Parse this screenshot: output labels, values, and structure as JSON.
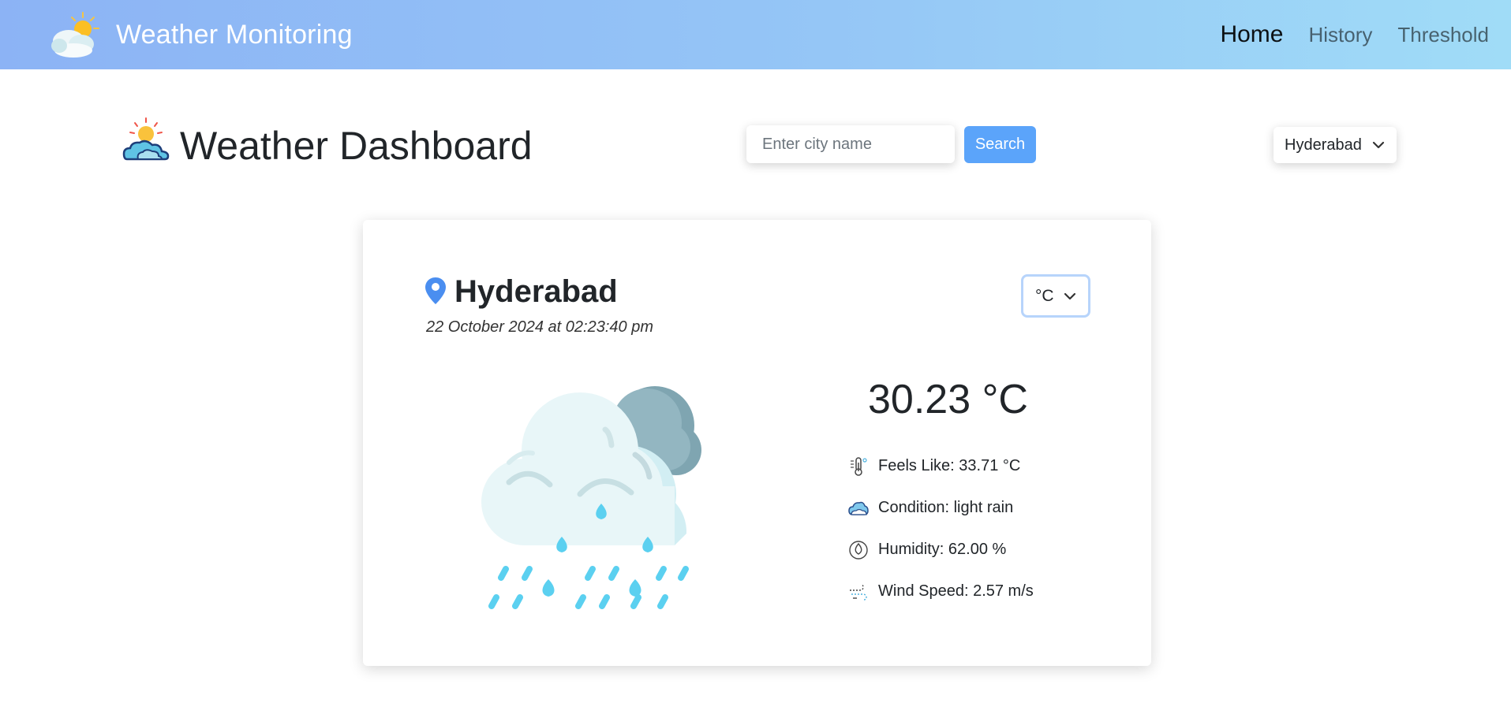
{
  "navbar": {
    "brand": "Weather Monitoring",
    "brand_icon": "sun-cloud-icon",
    "links": [
      {
        "label": "Home",
        "active": true
      },
      {
        "label": "History",
        "active": false
      },
      {
        "label": "Threshold",
        "active": false
      }
    ]
  },
  "header": {
    "title": "Weather Dashboard",
    "icon": "sun-cloud-icon",
    "search": {
      "placeholder": "Enter city name",
      "value": "",
      "button_label": "Search"
    },
    "city_select": {
      "selected": "Hyderabad"
    }
  },
  "card": {
    "city": "Hyderabad",
    "datetime": "22 October 2024 at 02:23:40 pm",
    "unit_select": {
      "selected": "°C"
    },
    "temperature": "30.23 °C",
    "illustration": "cloud-rain-icon",
    "details": [
      {
        "icon": "thermometer-icon",
        "text": "Feels Like: 33.71 °C"
      },
      {
        "icon": "cloud-icon",
        "text": "Condition: light rain"
      },
      {
        "icon": "humidity-drop-icon",
        "text": "Humidity: 62.00 %"
      },
      {
        "icon": "wind-icon",
        "text": "Wind Speed: 2.57 m/s"
      }
    ]
  },
  "colors": {
    "navbar_start": "#8cb3f5",
    "navbar_end": "#a0dcf7",
    "search_button": "#5ba4fa",
    "pin": "#4a8ef0",
    "rain": "#5bd0f0"
  }
}
